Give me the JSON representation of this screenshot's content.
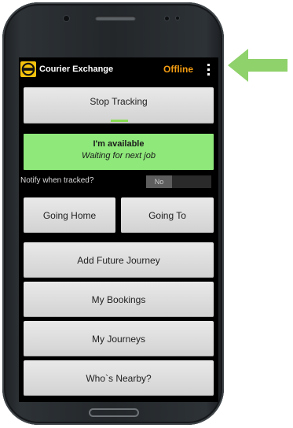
{
  "app": {
    "title": "Courier Exchange",
    "status": "Offline",
    "logo_icon": "courier-exchange-logo",
    "overflow_icon": "overflow-menu-icon"
  },
  "buttons": {
    "stop_tracking": "Stop Tracking",
    "going_home": "Going Home",
    "going_to": "Going To",
    "add_future_journey": "Add Future Journey",
    "my_bookings": "My Bookings",
    "my_journeys": "My Journeys",
    "whos_nearby": "Who`s Nearby?"
  },
  "availability": {
    "title": "I'm available",
    "subtitle": "Waiting for next job",
    "color": "#8ee87a"
  },
  "notify": {
    "label": "Notify when tracked?",
    "toggle_value": "No"
  },
  "colors": {
    "status_offline": "#f39c12",
    "logo": "#f4c20d",
    "annotation_arrow": "#8fd16b"
  }
}
